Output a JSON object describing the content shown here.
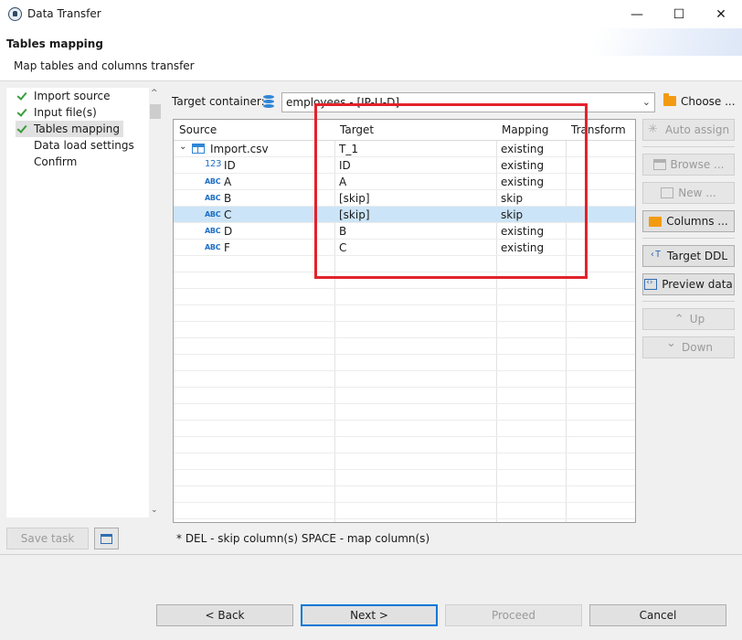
{
  "window": {
    "title": "Data Transfer",
    "controls": {
      "minimize": "—",
      "maximize": "☐",
      "close": "✕"
    }
  },
  "header": {
    "title": "Tables mapping",
    "subtitle": "Map tables and columns transfer"
  },
  "nav": {
    "items": [
      {
        "label": "Import source",
        "checked": true
      },
      {
        "label": "Input file(s)",
        "checked": true
      },
      {
        "label": "Tables mapping",
        "checked": true,
        "selected": true
      },
      {
        "label": "Data load settings",
        "checked": false
      },
      {
        "label": "Confirm",
        "checked": false
      }
    ]
  },
  "left_buttons": {
    "save_task": "Save task"
  },
  "target_container": {
    "label": "Target container:",
    "value": "employees - [IP-U-D]",
    "choose": "Choose ..."
  },
  "table": {
    "columns": [
      "Source",
      "Target",
      "Mapping",
      "Transform"
    ],
    "rows": [
      {
        "type": "table",
        "source": "Import.csv",
        "target": "T_1",
        "mapping": "existing",
        "transform": ""
      },
      {
        "type": "123",
        "source": "ID",
        "target": "ID",
        "mapping": "existing",
        "transform": ""
      },
      {
        "type": "ABC",
        "source": "A",
        "target": "A",
        "mapping": "existing",
        "transform": ""
      },
      {
        "type": "ABC",
        "source": "B",
        "target": "[skip]",
        "mapping": "skip",
        "transform": ""
      },
      {
        "type": "ABC",
        "source": "C",
        "target": "[skip]",
        "mapping": "skip",
        "transform": "",
        "selected": true
      },
      {
        "type": "ABC",
        "source": "D",
        "target": "B",
        "mapping": "existing",
        "transform": ""
      },
      {
        "type": "ABC",
        "source": "F",
        "target": "C",
        "mapping": "existing",
        "transform": ""
      }
    ]
  },
  "side_buttons": {
    "auto_assign": "Auto assign",
    "browse": "Browse ...",
    "new": "New ...",
    "columns": "Columns ...",
    "target_ddl": "Target DDL",
    "preview_data": "Preview data",
    "up": "Up",
    "down": "Down"
  },
  "hint": "* DEL - skip column(s)  SPACE - map column(s)",
  "footer": {
    "back": "< Back",
    "next": "Next >",
    "proceed": "Proceed",
    "cancel": "Cancel"
  },
  "colors": {
    "selection": "#cce4f7",
    "highlight_box": "#e3222b",
    "accent": "#0078d7",
    "check": "#3a9c3a",
    "type_icon": "#1e6fc4"
  }
}
